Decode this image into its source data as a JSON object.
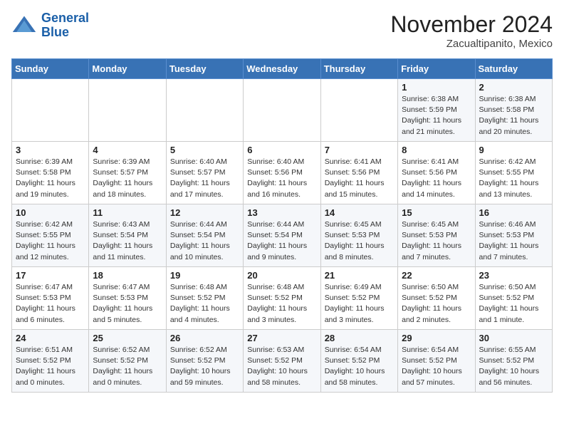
{
  "header": {
    "logo_line1": "General",
    "logo_line2": "Blue",
    "month": "November 2024",
    "location": "Zacualtipanito, Mexico"
  },
  "days_of_week": [
    "Sunday",
    "Monday",
    "Tuesday",
    "Wednesday",
    "Thursday",
    "Friday",
    "Saturday"
  ],
  "weeks": [
    [
      {
        "day": "",
        "content": ""
      },
      {
        "day": "",
        "content": ""
      },
      {
        "day": "",
        "content": ""
      },
      {
        "day": "",
        "content": ""
      },
      {
        "day": "",
        "content": ""
      },
      {
        "day": "1",
        "content": "Sunrise: 6:38 AM\nSunset: 5:59 PM\nDaylight: 11 hours and 21 minutes."
      },
      {
        "day": "2",
        "content": "Sunrise: 6:38 AM\nSunset: 5:58 PM\nDaylight: 11 hours and 20 minutes."
      }
    ],
    [
      {
        "day": "3",
        "content": "Sunrise: 6:39 AM\nSunset: 5:58 PM\nDaylight: 11 hours and 19 minutes."
      },
      {
        "day": "4",
        "content": "Sunrise: 6:39 AM\nSunset: 5:57 PM\nDaylight: 11 hours and 18 minutes."
      },
      {
        "day": "5",
        "content": "Sunrise: 6:40 AM\nSunset: 5:57 PM\nDaylight: 11 hours and 17 minutes."
      },
      {
        "day": "6",
        "content": "Sunrise: 6:40 AM\nSunset: 5:56 PM\nDaylight: 11 hours and 16 minutes."
      },
      {
        "day": "7",
        "content": "Sunrise: 6:41 AM\nSunset: 5:56 PM\nDaylight: 11 hours and 15 minutes."
      },
      {
        "day": "8",
        "content": "Sunrise: 6:41 AM\nSunset: 5:56 PM\nDaylight: 11 hours and 14 minutes."
      },
      {
        "day": "9",
        "content": "Sunrise: 6:42 AM\nSunset: 5:55 PM\nDaylight: 11 hours and 13 minutes."
      }
    ],
    [
      {
        "day": "10",
        "content": "Sunrise: 6:42 AM\nSunset: 5:55 PM\nDaylight: 11 hours and 12 minutes."
      },
      {
        "day": "11",
        "content": "Sunrise: 6:43 AM\nSunset: 5:54 PM\nDaylight: 11 hours and 11 minutes."
      },
      {
        "day": "12",
        "content": "Sunrise: 6:44 AM\nSunset: 5:54 PM\nDaylight: 11 hours and 10 minutes."
      },
      {
        "day": "13",
        "content": "Sunrise: 6:44 AM\nSunset: 5:54 PM\nDaylight: 11 hours and 9 minutes."
      },
      {
        "day": "14",
        "content": "Sunrise: 6:45 AM\nSunset: 5:53 PM\nDaylight: 11 hours and 8 minutes."
      },
      {
        "day": "15",
        "content": "Sunrise: 6:45 AM\nSunset: 5:53 PM\nDaylight: 11 hours and 7 minutes."
      },
      {
        "day": "16",
        "content": "Sunrise: 6:46 AM\nSunset: 5:53 PM\nDaylight: 11 hours and 7 minutes."
      }
    ],
    [
      {
        "day": "17",
        "content": "Sunrise: 6:47 AM\nSunset: 5:53 PM\nDaylight: 11 hours and 6 minutes."
      },
      {
        "day": "18",
        "content": "Sunrise: 6:47 AM\nSunset: 5:53 PM\nDaylight: 11 hours and 5 minutes."
      },
      {
        "day": "19",
        "content": "Sunrise: 6:48 AM\nSunset: 5:52 PM\nDaylight: 11 hours and 4 minutes."
      },
      {
        "day": "20",
        "content": "Sunrise: 6:48 AM\nSunset: 5:52 PM\nDaylight: 11 hours and 3 minutes."
      },
      {
        "day": "21",
        "content": "Sunrise: 6:49 AM\nSunset: 5:52 PM\nDaylight: 11 hours and 3 minutes."
      },
      {
        "day": "22",
        "content": "Sunrise: 6:50 AM\nSunset: 5:52 PM\nDaylight: 11 hours and 2 minutes."
      },
      {
        "day": "23",
        "content": "Sunrise: 6:50 AM\nSunset: 5:52 PM\nDaylight: 11 hours and 1 minute."
      }
    ],
    [
      {
        "day": "24",
        "content": "Sunrise: 6:51 AM\nSunset: 5:52 PM\nDaylight: 11 hours and 0 minutes."
      },
      {
        "day": "25",
        "content": "Sunrise: 6:52 AM\nSunset: 5:52 PM\nDaylight: 11 hours and 0 minutes."
      },
      {
        "day": "26",
        "content": "Sunrise: 6:52 AM\nSunset: 5:52 PM\nDaylight: 10 hours and 59 minutes."
      },
      {
        "day": "27",
        "content": "Sunrise: 6:53 AM\nSunset: 5:52 PM\nDaylight: 10 hours and 58 minutes."
      },
      {
        "day": "28",
        "content": "Sunrise: 6:54 AM\nSunset: 5:52 PM\nDaylight: 10 hours and 58 minutes."
      },
      {
        "day": "29",
        "content": "Sunrise: 6:54 AM\nSunset: 5:52 PM\nDaylight: 10 hours and 57 minutes."
      },
      {
        "day": "30",
        "content": "Sunrise: 6:55 AM\nSunset: 5:52 PM\nDaylight: 10 hours and 56 minutes."
      }
    ]
  ]
}
